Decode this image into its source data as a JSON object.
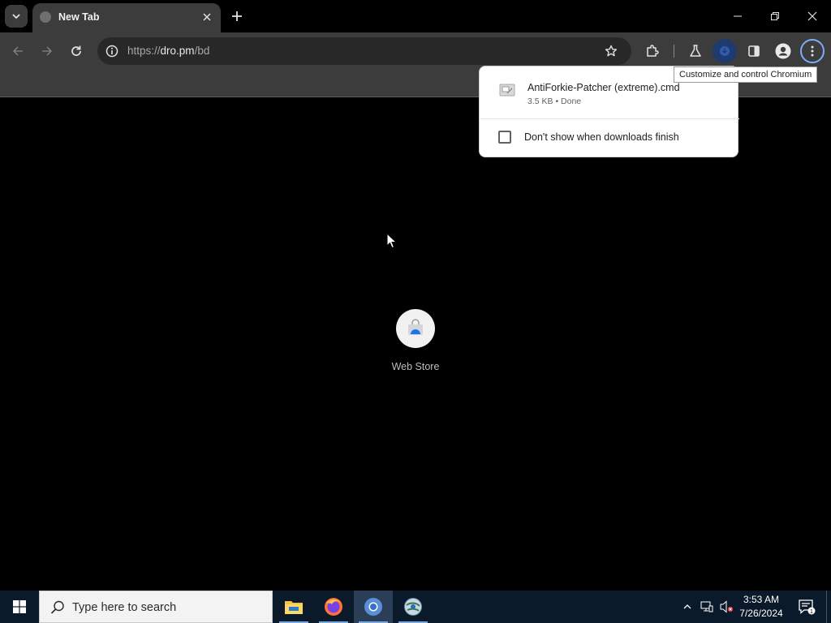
{
  "browser": {
    "tab": {
      "title": "New Tab"
    },
    "address_bar": {
      "url_scheme": "https://",
      "url_host": "dro.pm",
      "url_path": "/bd"
    },
    "tooltip": "Customize and control Chromium",
    "download_bubble": {
      "file_name": "AntiForkie-Patcher (extreme).cmd",
      "file_status": "3.5 KB • Done",
      "checkbox_label": "Don't show when downloads finish",
      "checkbox_checked": false
    }
  },
  "new_tab_page": {
    "shortcuts": [
      {
        "label": "Web Store"
      }
    ]
  },
  "taskbar": {
    "search_placeholder": "Type here to search",
    "apps": [
      "file-explorer-icon",
      "firefox-icon",
      "chromium-icon",
      "network-globe-icon"
    ],
    "clock": {
      "time": "3:53 AM",
      "date": "7/26/2024"
    },
    "notification_count": "1"
  },
  "colors": {
    "accent": "#7cacf8",
    "toolbar": "#3c3c3c",
    "background": "#000000",
    "taskbar": "#0b1a2b"
  }
}
